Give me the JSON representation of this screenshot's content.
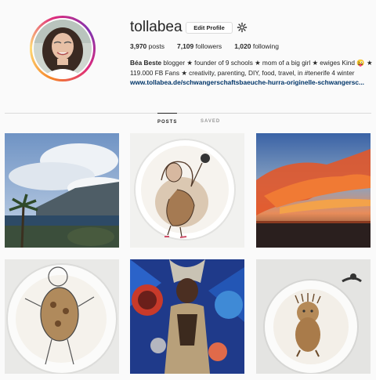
{
  "profile": {
    "username": "tollabea",
    "edit_profile_label": "Edit Profile",
    "stats": {
      "posts_count": "3,970",
      "posts_label": "posts",
      "followers_count": "7,109",
      "followers_label": "followers",
      "following_count": "1,020",
      "following_label": "following"
    },
    "bio": {
      "name": "Béa Beste",
      "text": " blogger ★ founder of 9 schools ★ mom of a big girl ★ ewiges Kind 😜 ★ 119.000 FB Fans ★ creativity, parenting, DIY, food, travel, in #tenerife 4 winter",
      "link": "www.tollabea.de/schwangerschaftsbaeuche-hurra-originelle-schwangersc..."
    }
  },
  "tabs": {
    "posts": "POSTS",
    "saved": "SAVED"
  },
  "posts": [
    {
      "id": "post-coast"
    },
    {
      "id": "post-latte-dancer"
    },
    {
      "id": "post-sunset"
    },
    {
      "id": "post-latte-child"
    },
    {
      "id": "post-carnival"
    },
    {
      "id": "post-latte-baby"
    }
  ],
  "colors": {
    "link": "#003569",
    "border": "#dbdbdb",
    "background": "#fafafa"
  }
}
